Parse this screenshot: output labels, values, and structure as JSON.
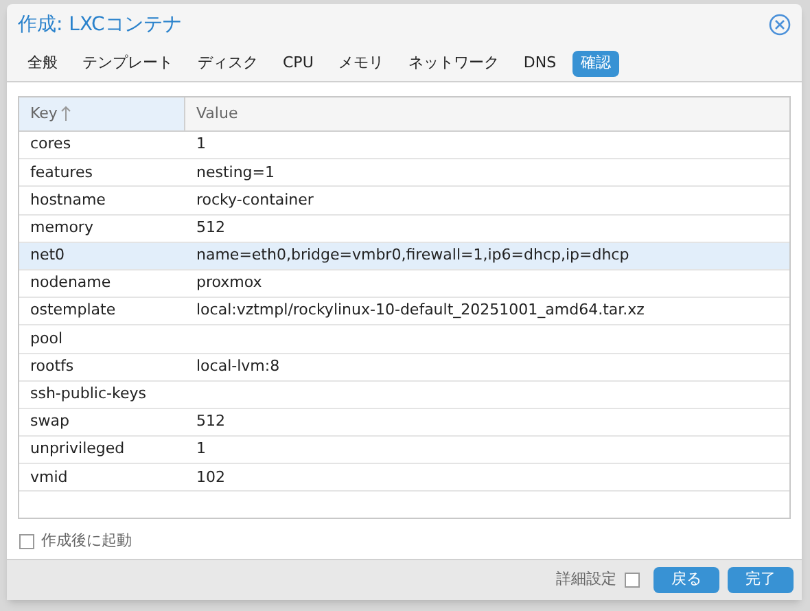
{
  "window": {
    "title": "作成: LXCコンテナ"
  },
  "tabs": [
    {
      "label": "全般",
      "selected": false
    },
    {
      "label": "テンプレート",
      "selected": false
    },
    {
      "label": "ディスク",
      "selected": false
    },
    {
      "label": "CPU",
      "selected": false
    },
    {
      "label": "メモリ",
      "selected": false
    },
    {
      "label": "ネットワーク",
      "selected": false
    },
    {
      "label": "DNS",
      "selected": false
    },
    {
      "label": "確認",
      "selected": true
    }
  ],
  "table": {
    "columns": [
      {
        "label": "Key",
        "sorted_ascending": true
      },
      {
        "label": "Value"
      }
    ],
    "rows": [
      {
        "key": "cores",
        "value": "1",
        "selected": false
      },
      {
        "key": "features",
        "value": "nesting=1",
        "selected": false
      },
      {
        "key": "hostname",
        "value": "rocky-container",
        "selected": false
      },
      {
        "key": "memory",
        "value": "512",
        "selected": false
      },
      {
        "key": "net0",
        "value": "name=eth0,bridge=vmbr0,firewall=1,ip6=dhcp,ip=dhcp",
        "selected": true
      },
      {
        "key": "nodename",
        "value": "proxmox",
        "selected": false
      },
      {
        "key": "ostemplate",
        "value": "local:vztmpl/rockylinux-10-default_20251001_amd64.tar.xz",
        "selected": false
      },
      {
        "key": "pool",
        "selected": false
      },
      {
        "key": "rootfs",
        "value": "local-lvm:8",
        "selected": false
      },
      {
        "key": "ssh-public-keys",
        "selected": false
      },
      {
        "key": "swap",
        "value": "512",
        "selected": false
      },
      {
        "key": "unprivileged",
        "value": "1",
        "selected": false
      },
      {
        "key": "vmid",
        "value": "102",
        "selected": false
      }
    ]
  },
  "start_after_create": {
    "label": "作成後に起動",
    "checked": false
  },
  "footer": {
    "advanced": {
      "label": "詳細設定",
      "checked": false
    },
    "buttons": [
      "戻る",
      "完了"
    ]
  }
}
